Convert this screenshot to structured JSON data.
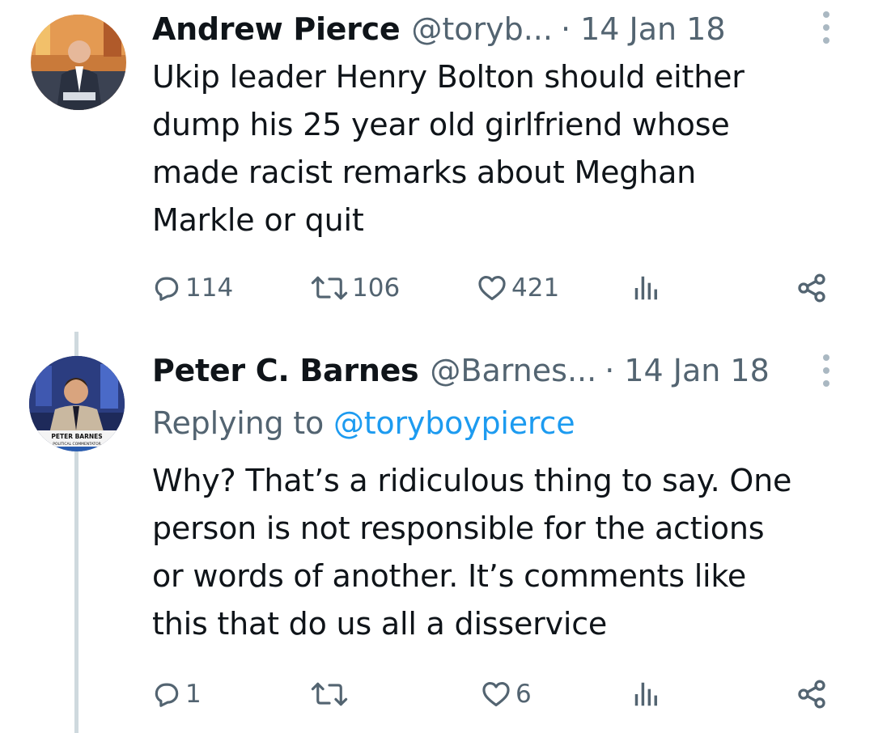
{
  "tweets": [
    {
      "author_name": "Andrew Pierce",
      "handle": "@toryb...",
      "date": "· 14 Jan 18",
      "text_lines": [
        "Ukip leader Henry Bolton should either",
        "dump his 25 year old girlfriend whose",
        "made racist remarks about Meghan",
        "Markle or quit"
      ],
      "replies": "114",
      "retweets": "106",
      "likes": "421"
    },
    {
      "author_name": "Peter C. Barnes",
      "handle": "@Barnes...",
      "date": "· 14 Jan 18",
      "replying_label": "Replying to",
      "replying_to": "@toryboypierce",
      "text_lines": [
        "Why? That’s a ridiculous thing to say. One",
        "person is not responsible for the actions",
        "or words of another. It’s comments like",
        "this that do us all a disservice"
      ],
      "replies": "1",
      "retweets": "",
      "likes": "6",
      "avatar_caption": "PETER BARNES",
      "avatar_subcaption": "POLITICAL COMMENTATOR"
    }
  ],
  "icons": {
    "reply": "speech-bubble-icon",
    "retweet": "retweet-arrows-icon",
    "like": "heart-icon",
    "views": "bar-chart-icon",
    "share": "share-nodes-icon",
    "more": "vertical-ellipsis-icon"
  },
  "colors": {
    "text": "#0f1419",
    "secondary": "#536471",
    "link": "#1d9bf0",
    "thread_line": "#cfd9de"
  }
}
